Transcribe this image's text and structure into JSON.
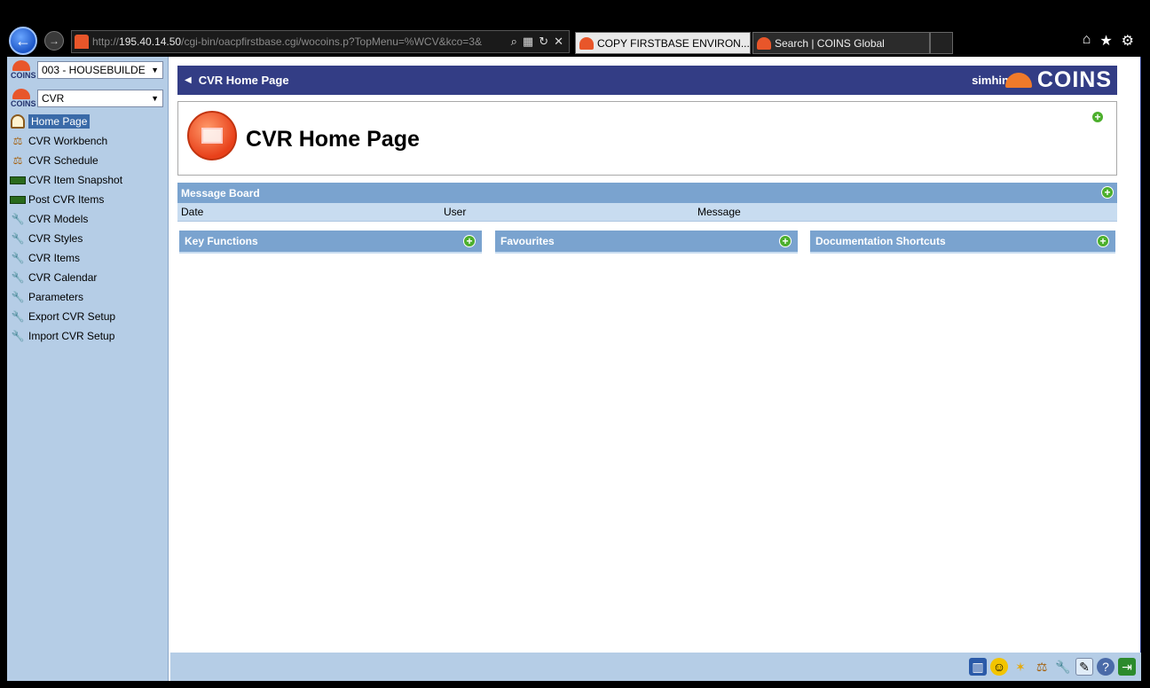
{
  "browser": {
    "url_prefix": "http://",
    "url_host": "195.40.14.50",
    "url_path": "/cgi-bin/oacpfirstbase.cgi/wocoins.p?TopMenu=%WCV&kco=3&",
    "tabs": [
      {
        "label": "COPY FIRSTBASE ENVIRON...",
        "close": "✕"
      },
      {
        "label": "Search | COINS Global"
      }
    ],
    "icons": [
      "back-icon",
      "forward-icon",
      "search-icon",
      "refresh-icon",
      "stop-icon",
      "home-icon",
      "favorites-star-icon",
      "settings-gear-icon"
    ]
  },
  "sidebar": {
    "company_select": "003 - HOUSEBUILDE",
    "module_select": "CVR",
    "logo_text": "COINS",
    "items": [
      {
        "label": "Home Page",
        "icon": "house-icon",
        "selected": true
      },
      {
        "label": "CVR Workbench",
        "icon": "scales-icon"
      },
      {
        "label": "CVR Schedule",
        "icon": "scales-icon"
      },
      {
        "label": "CVR Item Snapshot",
        "icon": "tape-measure-icon"
      },
      {
        "label": "Post CVR Items",
        "icon": "tape-measure-icon"
      },
      {
        "label": "CVR Models",
        "icon": "wrench-icon"
      },
      {
        "label": "CVR Styles",
        "icon": "wrench-icon"
      },
      {
        "label": "CVR Items",
        "icon": "wrench-icon"
      },
      {
        "label": "CVR Calendar",
        "icon": "wrench-icon"
      },
      {
        "label": "Parameters",
        "icon": "wrench-icon"
      },
      {
        "label": "Export CVR Setup",
        "icon": "wrench-icon"
      },
      {
        "label": "Import CVR Setup",
        "icon": "wrench-icon"
      }
    ]
  },
  "main": {
    "title_bar": "CVR Home Page",
    "user": "simhin",
    "logo_word": "COINS",
    "heading": "CVR Home Page",
    "message_board": {
      "title": "Message Board",
      "columns": [
        "Date",
        "User",
        "Message"
      ]
    },
    "panels": [
      {
        "title": "Key Functions"
      },
      {
        "title": "Favourites"
      },
      {
        "title": "Documentation Shortcuts"
      }
    ]
  },
  "status_bar_icons": [
    "books-icon",
    "smiley-icon",
    "star-icon",
    "scales-icon",
    "wrench-icon",
    "notes-icon",
    "help-icon",
    "exit-door-icon"
  ],
  "colors": {
    "title_bar": "#333d85",
    "sidebar": "#b5cde6",
    "panel_header": "#7aa3cf",
    "accent_orange": "#e8562a"
  }
}
